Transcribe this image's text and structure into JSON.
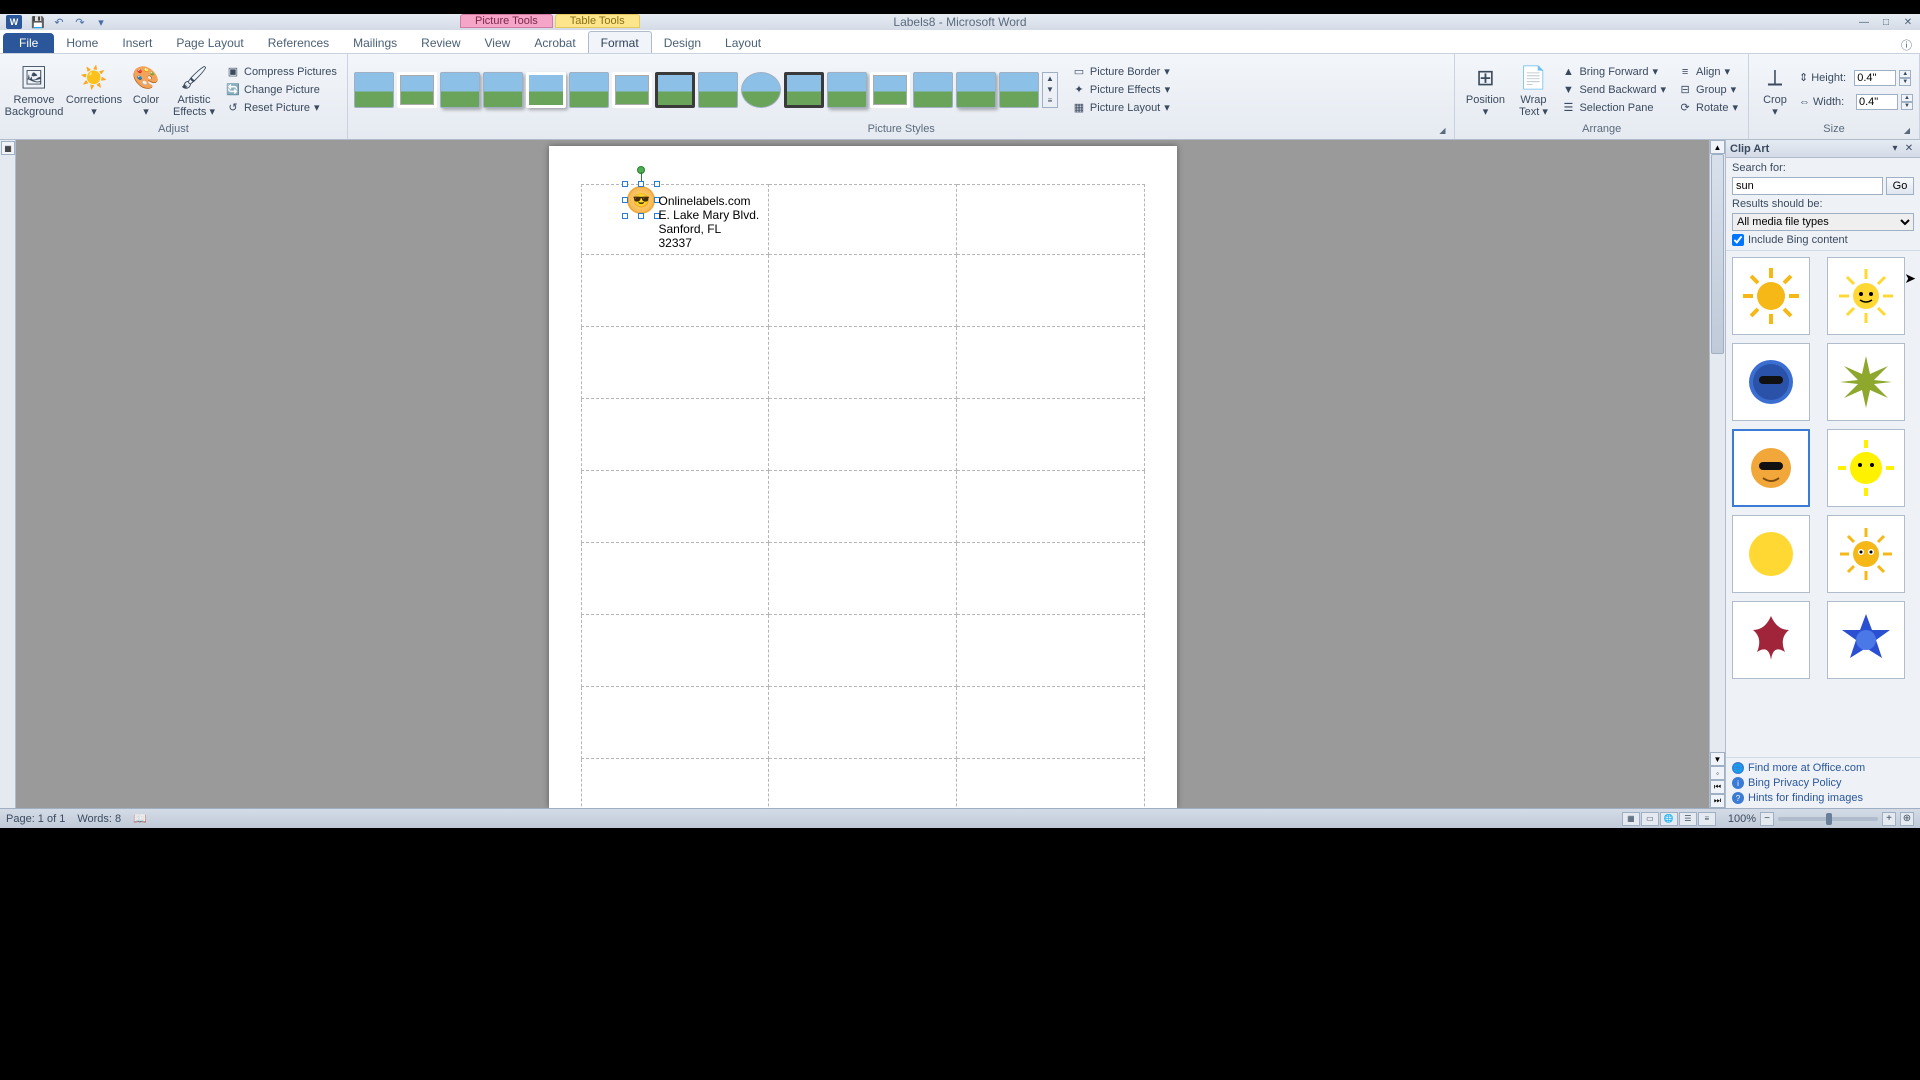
{
  "window": {
    "doc_title": "Labels8 - Microsoft Word"
  },
  "qat": {
    "save": "💾",
    "undo": "↶",
    "redo": "↷"
  },
  "contextual": {
    "picture": "Picture Tools",
    "table": "Table Tools"
  },
  "tabs": {
    "file": "File",
    "home": "Home",
    "insert": "Insert",
    "pagelayout": "Page Layout",
    "references": "References",
    "mailings": "Mailings",
    "review": "Review",
    "view": "View",
    "acrobat": "Acrobat",
    "format": "Format",
    "design": "Design",
    "layout": "Layout"
  },
  "ribbon": {
    "adjust": {
      "remove_bg1": "Remove",
      "remove_bg2": "Background",
      "corrections": "Corrections",
      "color": "Color",
      "artistic1": "Artistic",
      "artistic2": "Effects",
      "compress": "Compress Pictures",
      "change": "Change Picture",
      "reset": "Reset Picture",
      "label": "Adjust"
    },
    "styles": {
      "border": "Picture Border",
      "effects": "Picture Effects",
      "layout": "Picture Layout",
      "label": "Picture Styles"
    },
    "arrange": {
      "position": "Position",
      "wrap1": "Wrap",
      "wrap2": "Text",
      "forward": "Bring Forward",
      "backward": "Send Backward",
      "selection": "Selection Pane",
      "align": "Align",
      "group": "Group",
      "rotate": "Rotate",
      "label": "Arrange"
    },
    "size": {
      "crop": "Crop",
      "height_l": "Height:",
      "width_l": "Width:",
      "height_v": "0.4\"",
      "width_v": "0.4\"",
      "label": "Size"
    }
  },
  "document": {
    "address": {
      "l1": "Onlinelabels.com",
      "l2": "E. Lake Mary Blvd.",
      "l3": "Sanford, FL",
      "l4": "32337"
    }
  },
  "clipart": {
    "title": "Clip Art",
    "search_label": "Search for:",
    "search_value": "sun",
    "go": "Go",
    "results_label": "Results should be:",
    "results_value": "All media file types",
    "include_bing": "Include Bing content",
    "link1": "Find more at Office.com",
    "link2": "Bing Privacy Policy",
    "link3": "Hints for finding images"
  },
  "status": {
    "page": "Page: 1 of 1",
    "words": "Words: 8",
    "zoom": "100%"
  }
}
